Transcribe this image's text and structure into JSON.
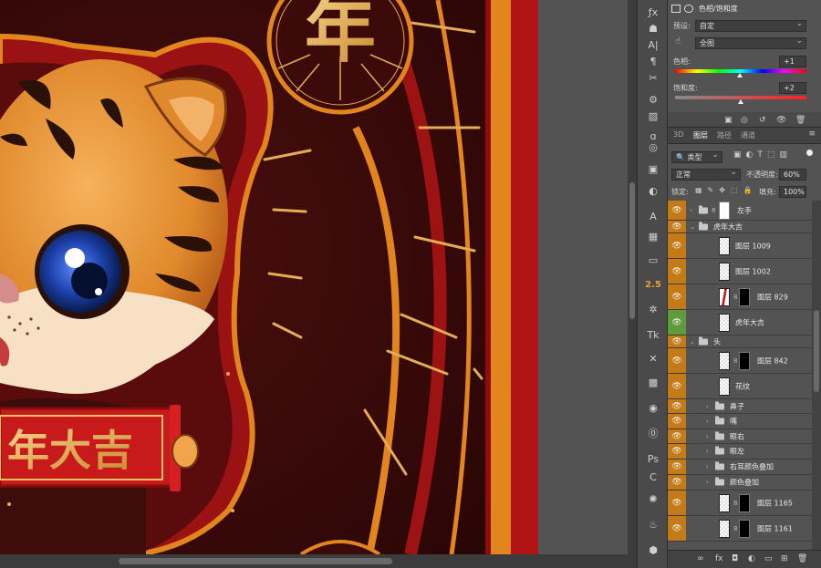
{
  "canvas": {
    "year_char": "年",
    "banner_text": "年大吉"
  },
  "tools": [
    {
      "glyph": "ƒx"
    },
    {
      "glyph": "☗"
    },
    {
      "glyph": "A|"
    },
    {
      "glyph": "¶"
    },
    {
      "glyph": "✂"
    },
    {
      "glyph": "⚙"
    },
    {
      "glyph": "▨"
    },
    {
      "glyph": "ɑ"
    },
    {
      "glyph": "◎"
    },
    {
      "glyph": "▣"
    },
    {
      "glyph": "◐"
    },
    {
      "glyph": "A"
    },
    {
      "glyph": "▦"
    },
    {
      "glyph": "▭"
    },
    {
      "glyph": "2.5"
    },
    {
      "glyph": "✲"
    },
    {
      "glyph": "Tk"
    },
    {
      "glyph": "✕"
    },
    {
      "glyph": "▩"
    },
    {
      "glyph": "◉"
    },
    {
      "glyph": "⓪"
    },
    {
      "glyph": "Ps"
    },
    {
      "glyph": "C"
    },
    {
      "glyph": "✺"
    },
    {
      "glyph": "♨"
    },
    {
      "glyph": "⬢"
    }
  ],
  "properties": {
    "title": "色相/饱和度",
    "preset_label": "预设:",
    "preset_value": "自定",
    "channel_value": "全图",
    "hue_label": "色相:",
    "hue_value": "+1",
    "saturation_label": "饱和度:",
    "saturation_value": "+2"
  },
  "layers_panel": {
    "tabs": [
      {
        "label": "3D",
        "active": false
      },
      {
        "label": "图层",
        "active": true
      },
      {
        "label": "路径",
        "active": false
      },
      {
        "label": "通道",
        "active": false
      }
    ],
    "filter_value": "类型",
    "blend_mode": "正常",
    "opacity_label": "不透明度:",
    "opacity_value": "60%",
    "lock_label": "锁定:",
    "fill_label": "填充:",
    "fill_value": "100%"
  },
  "layers": [
    {
      "name": "左手",
      "kind": "group-collapsed",
      "indent": 1,
      "vis": "orange",
      "h": 22
    },
    {
      "name": "虎年大吉",
      "kind": "group-open",
      "indent": 1,
      "vis": "orange",
      "h": 14
    },
    {
      "name": "图层 1009",
      "kind": "layer",
      "indent": 2,
      "vis": "orange",
      "h": 28
    },
    {
      "name": "图层 1002",
      "kind": "layer",
      "indent": 2,
      "vis": "orange",
      "h": 28
    },
    {
      "name": "图层 829",
      "kind": "layer-mask-red",
      "indent": 2,
      "vis": "orange",
      "h": 28
    },
    {
      "name": "虎年大吉",
      "kind": "smart",
      "indent": 2,
      "vis": "green",
      "h": 28
    },
    {
      "name": "头",
      "kind": "group-open",
      "indent": 1,
      "vis": "orange",
      "h": 14
    },
    {
      "name": "图层 842",
      "kind": "layer-mask",
      "indent": 2,
      "vis": "orange",
      "h": 28
    },
    {
      "name": "花纹",
      "kind": "layer",
      "indent": 2,
      "vis": "orange",
      "h": 28
    },
    {
      "name": "鼻子",
      "kind": "group-collapsed",
      "indent": 2,
      "vis": "orange",
      "h": 16
    },
    {
      "name": "嘴",
      "kind": "group-collapsed",
      "indent": 2,
      "vis": "orange",
      "h": 17
    },
    {
      "name": "眼右",
      "kind": "group-collapsed",
      "indent": 2,
      "vis": "orange",
      "h": 16
    },
    {
      "name": "眼左",
      "kind": "group-collapsed",
      "indent": 2,
      "vis": "orange",
      "h": 17
    },
    {
      "name": "右耳颜色叠加",
      "kind": "group-collapsed",
      "indent": 2,
      "vis": "orange",
      "h": 17
    },
    {
      "name": "颜色叠加",
      "kind": "group-collapsed",
      "indent": 2,
      "vis": "orange",
      "h": 17
    },
    {
      "name": "图层 1165",
      "kind": "layer-mask",
      "indent": 2,
      "vis": "orange",
      "h": 28
    },
    {
      "name": "图层 1161",
      "kind": "layer-mask",
      "indent": 2,
      "vis": "orange",
      "h": 28
    }
  ],
  "footer_icons": [
    "link-icon",
    "fx-icon",
    "mask-icon",
    "adjustment-icon",
    "folder-icon",
    "new-layer-icon",
    "trash-icon"
  ],
  "colors": {
    "highlight": "#c47a16",
    "selected_green": "#5f9b3c",
    "panel_bg": "#535353"
  }
}
